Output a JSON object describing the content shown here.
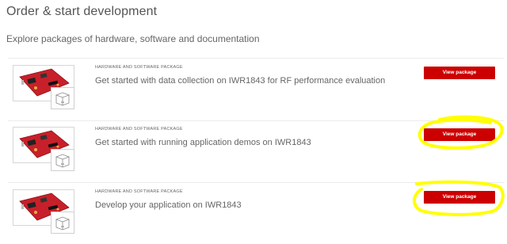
{
  "header": {
    "title": "Order & start development",
    "subtitle": "Explore packages of hardware, software and documentation"
  },
  "packages": [
    {
      "category": "HARDWARE AND SOFTWARE PACKAGE",
      "title": "Get started with data collection on IWR1843 for RF performance evaluation",
      "button_label": "View package",
      "box_icon_text": "co"
    },
    {
      "category": "HARDWARE AND SOFTWARE PACKAGE",
      "title": "Get started with running application demos on IWR1843",
      "button_label": "View package",
      "box_icon_text": "co"
    },
    {
      "category": "HARDWARE AND SOFTWARE PACKAGE",
      "title": "Develop your application on IWR1843",
      "button_label": "View package",
      "box_icon_text": "co"
    }
  ],
  "colors": {
    "button": "#cc0000",
    "highlight": "#ffff00",
    "board": "#c8202a"
  },
  "annotations": {
    "highlighted_buttons": [
      1,
      2
    ]
  }
}
